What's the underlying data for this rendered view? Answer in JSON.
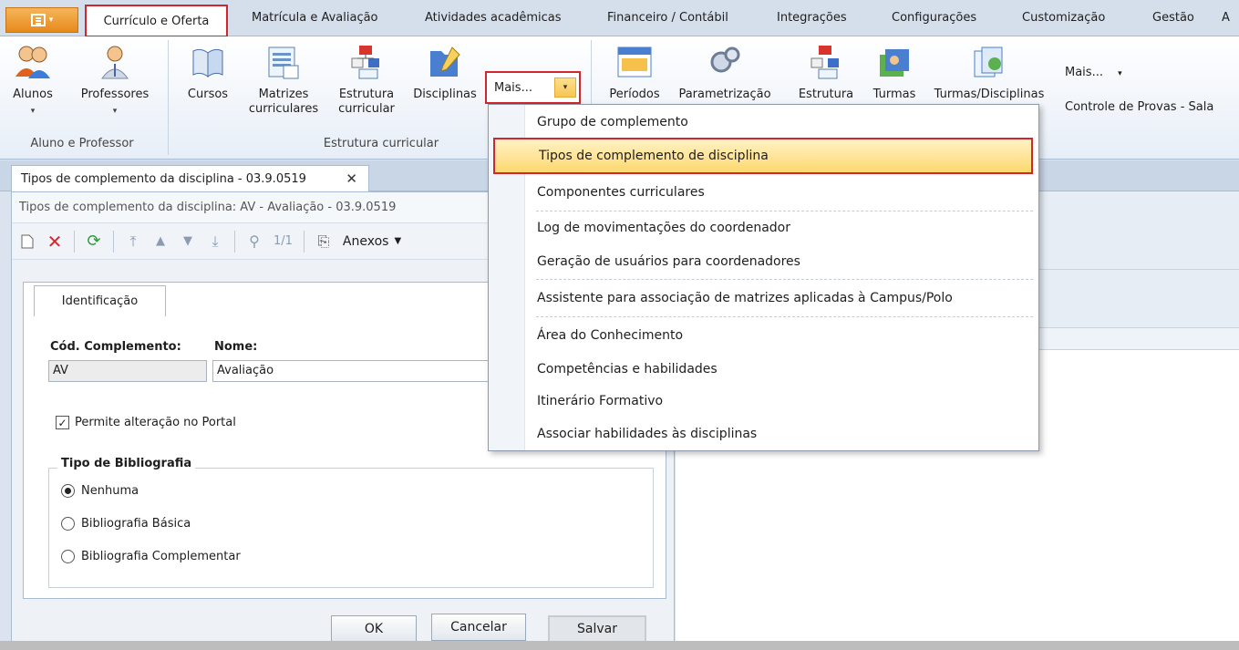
{
  "tabs": [
    "Currículo e Oferta",
    "Matrícula e Avaliação",
    "Atividades acadêmicas",
    "Financeiro / Contábil",
    "Integrações",
    "Configurações",
    "Customização",
    "Gestão",
    "A"
  ],
  "ribbon": {
    "alunos": "Alunos",
    "professores": "Professores",
    "cursos": "Cursos",
    "matrizes_l1": "Matrizes",
    "matrizes_l2": "curriculares",
    "estrutura_l1": "Estrutura",
    "estrutura_l2": "curricular",
    "disciplinas": "Disciplinas",
    "mais": "Mais...",
    "mais2": "Mais...",
    "controle": "Controle de Provas - Sala",
    "periodos": "Períodos",
    "parametrizacao": "Parametrização",
    "estrutura2": "Estrutura",
    "turmas": "Turmas",
    "turmas_disciplinas": "Turmas/Disciplinas",
    "group_aluno": "Aluno e Professor",
    "group_estrutura": "Estrutura curricular"
  },
  "doc_tab": {
    "label": "Tipos de complemento da disciplina - 03.9.0519",
    "close": "✕"
  },
  "form": {
    "title": "Tipos de complemento da disciplina: AV - Avaliação - 03.9.0519",
    "page_counter": "1/1",
    "anexos": "Anexos",
    "tab_label": "Identificação",
    "cod_label": "Cód. Complemento:",
    "cod_value": "AV",
    "nome_label": "Nome:",
    "nome_value": "Avaliação",
    "permite_label": "Permite alteração no Portal",
    "tipo_bib_label": "Tipo de Bibliografia",
    "radio_options": [
      "Nenhuma",
      "Bibliografia Básica",
      "Bibliografia Complementar"
    ],
    "selected": "Nenhuma",
    "ok": "OK",
    "cancelar": "Cancelar",
    "salvar": "Salvar"
  },
  "menu": {
    "items": [
      "Grupo de complemento",
      "Tipos de complemento de disciplina",
      "Componentes curriculares",
      "Log de movimentações do coordenador",
      "Geração de usuários para coordenadores",
      "Assistente para associação de matrizes aplicadas à Campus/Polo",
      "Área do Conhecimento",
      "Competências e habilidades",
      "Itinerário Formativo",
      "Associar habilidades às disciplinas"
    ],
    "highlighted_index": 1
  },
  "colors": {
    "highlight_border": "#d0262c",
    "app_button": "#e78a1b",
    "menu_highlight": "#fcd86f"
  }
}
